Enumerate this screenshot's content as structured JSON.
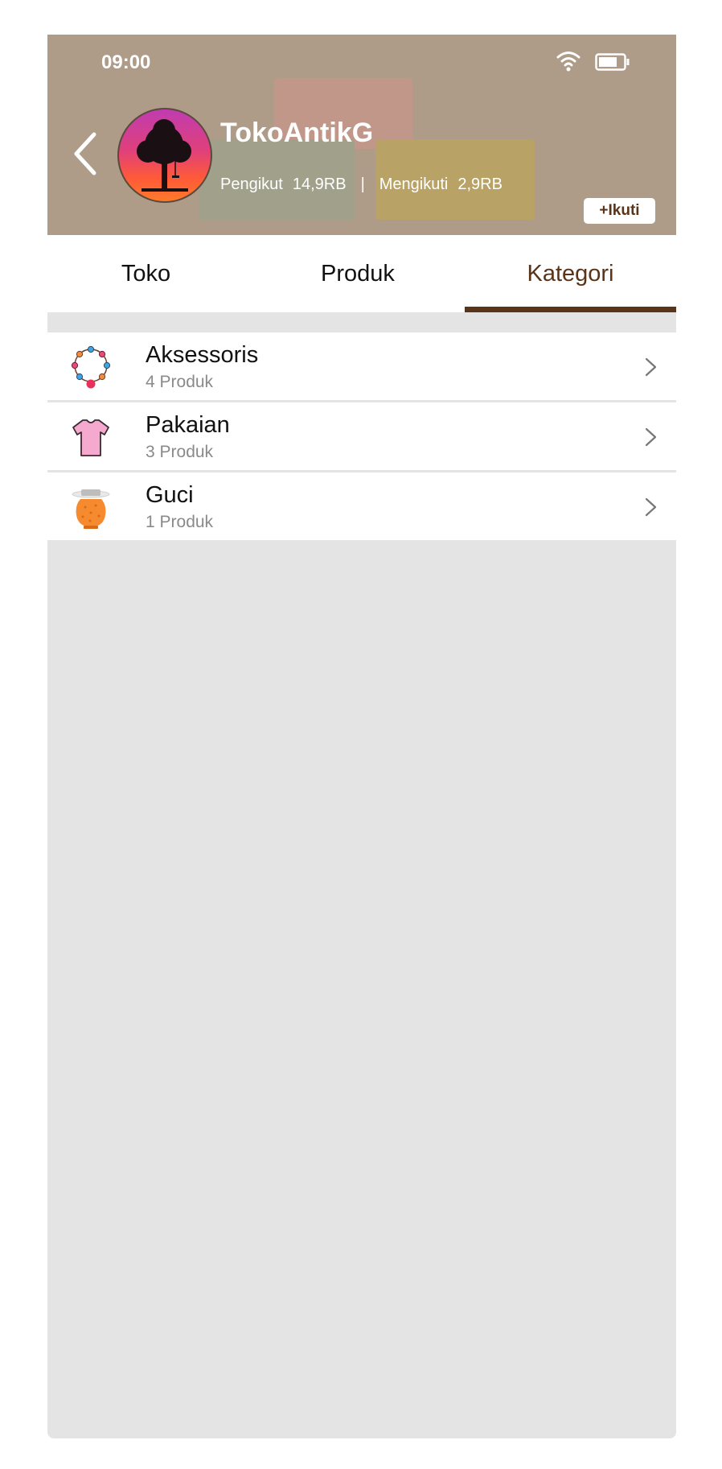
{
  "status_bar": {
    "time": "09:00"
  },
  "header": {
    "shop_name": "TokoAntikG",
    "followers_label": "Pengikut",
    "followers_count": "14,9RB",
    "separator": "|",
    "following_label": "Mengikuti",
    "following_count": "2,9RB",
    "follow_button": "+Ikuti"
  },
  "tabs": [
    {
      "label": "Toko",
      "active": false
    },
    {
      "label": "Produk",
      "active": false
    },
    {
      "label": "Kategori",
      "active": true
    }
  ],
  "categories": [
    {
      "name": "Aksessoris",
      "count": "4 Produk",
      "icon": "necklace-icon"
    },
    {
      "name": "Pakaian",
      "count": "3 Produk",
      "icon": "tshirt-icon"
    },
    {
      "name": "Guci",
      "count": "1 Produk",
      "icon": "jar-icon"
    }
  ],
  "colors": {
    "accent": "#5a3418",
    "background": "#e4e4e4",
    "header": "#b3a08e"
  }
}
